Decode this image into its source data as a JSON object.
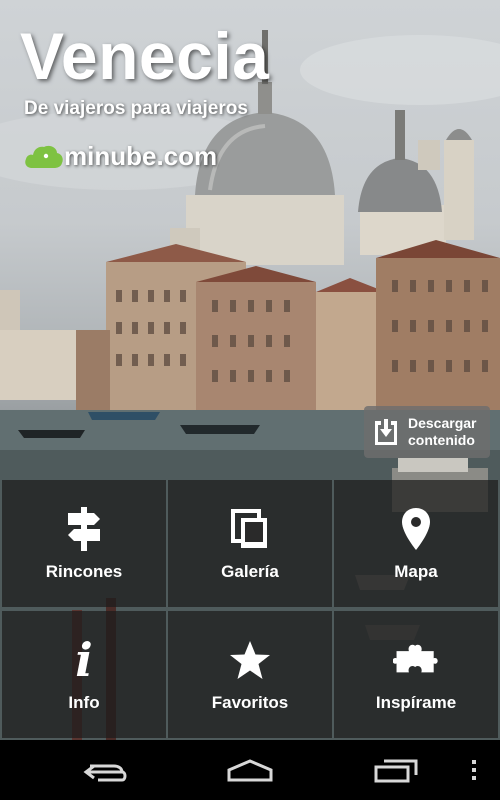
{
  "header": {
    "title": "Venecia",
    "subtitle": "De viajeros para viajeros",
    "brand": "minube.com",
    "brand_icon": "cloud-logo-icon",
    "brand_color": "#7ec242"
  },
  "download": {
    "label_line1": "Descargar",
    "label_line2": "contenido",
    "icon": "download-icon"
  },
  "menu": [
    {
      "label": "Rincones",
      "icon": "signpost-icon"
    },
    {
      "label": "Galería",
      "icon": "gallery-icon"
    },
    {
      "label": "Mapa",
      "icon": "map-pin-icon"
    },
    {
      "label": "Info",
      "icon": "info-icon"
    },
    {
      "label": "Favoritos",
      "icon": "star-icon"
    },
    {
      "label": "Inspírame",
      "icon": "puzzle-icon"
    }
  ],
  "navbar": {
    "back_icon": "back-icon",
    "home_icon": "home-icon",
    "recents_icon": "recent-apps-icon",
    "menu_icon": "overflow-menu-icon"
  }
}
